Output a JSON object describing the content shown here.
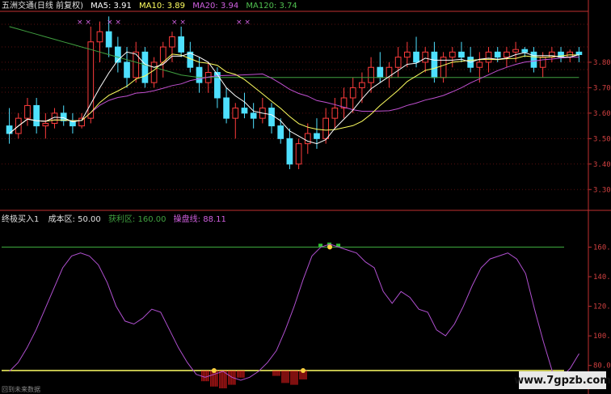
{
  "header": {
    "title": "五洲交通(日线 前复权)",
    "ma5": "MA5: 3.91",
    "ma10": "MA10: 3.89",
    "ma20": "MA20: 3.94",
    "ma120": "MA120: 3.74"
  },
  "indicator_header": {
    "name": "终极买入1",
    "cost": "成本区: 50.00",
    "profit": "获利区: 160.00",
    "trader": "操盘线: 88.11"
  },
  "footer_label": "回到未来数据",
  "watermark": "www.7gpzb.com",
  "colors": {
    "up": "#ff3c3c",
    "down": "#4ee0ff",
    "ma5": "#ffffff",
    "ma10": "#ffff60",
    "ma20": "#c050d0",
    "ma120": "#40a040",
    "trader_line": "#b050d0",
    "cost_line": "#ffff66",
    "profit_line": "#40b040",
    "axis": "#c03030"
  },
  "chart_data": [
    {
      "type": "candlestick",
      "title": "五洲交通(日线 前复权)",
      "ylim": [
        3.25,
        4.0
      ],
      "y_ticks": [
        "3.80",
        "3.70",
        "3.60",
        "3.50",
        "3.40",
        "3.30"
      ],
      "candles": [
        [
          3.55,
          3.62,
          3.48,
          3.52
        ],
        [
          3.52,
          3.6,
          3.5,
          3.58
        ],
        [
          3.58,
          3.66,
          3.55,
          3.63
        ],
        [
          3.63,
          3.66,
          3.52,
          3.55
        ],
        [
          3.55,
          3.6,
          3.5,
          3.56
        ],
        [
          3.56,
          3.62,
          3.54,
          3.6
        ],
        [
          3.6,
          3.63,
          3.55,
          3.57
        ],
        [
          3.57,
          3.6,
          3.52,
          3.55
        ],
        [
          3.55,
          3.6,
          3.54,
          3.58
        ],
        [
          3.58,
          3.94,
          3.56,
          3.88
        ],
        [
          3.88,
          3.96,
          3.8,
          3.92
        ],
        [
          3.92,
          3.98,
          3.82,
          3.86
        ],
        [
          3.86,
          3.9,
          3.76,
          3.8
        ],
        [
          3.8,
          3.86,
          3.7,
          3.74
        ],
        [
          3.74,
          3.88,
          3.72,
          3.84
        ],
        [
          3.84,
          3.86,
          3.7,
          3.72
        ],
        [
          3.72,
          3.82,
          3.7,
          3.8
        ],
        [
          3.8,
          3.88,
          3.74,
          3.86
        ],
        [
          3.86,
          3.92,
          3.8,
          3.9
        ],
        [
          3.9,
          3.94,
          3.82,
          3.84
        ],
        [
          3.84,
          3.88,
          3.76,
          3.78
        ],
        [
          3.78,
          3.82,
          3.68,
          3.72
        ],
        [
          3.72,
          3.8,
          3.68,
          3.76
        ],
        [
          3.76,
          3.78,
          3.62,
          3.66
        ],
        [
          3.66,
          3.7,
          3.56,
          3.58
        ],
        [
          3.58,
          3.64,
          3.5,
          3.62
        ],
        [
          3.62,
          3.68,
          3.58,
          3.6
        ],
        [
          3.6,
          3.64,
          3.54,
          3.58
        ],
        [
          3.58,
          3.66,
          3.56,
          3.62
        ],
        [
          3.62,
          3.64,
          3.52,
          3.55
        ],
        [
          3.55,
          3.58,
          3.48,
          3.5
        ],
        [
          3.5,
          3.54,
          3.38,
          3.4
        ],
        [
          3.4,
          3.5,
          3.38,
          3.48
        ],
        [
          3.48,
          3.56,
          3.44,
          3.52
        ],
        [
          3.52,
          3.58,
          3.46,
          3.5
        ],
        [
          3.5,
          3.62,
          3.48,
          3.58
        ],
        [
          3.58,
          3.66,
          3.54,
          3.62
        ],
        [
          3.62,
          3.7,
          3.58,
          3.66
        ],
        [
          3.66,
          3.74,
          3.6,
          3.7
        ],
        [
          3.7,
          3.76,
          3.64,
          3.72
        ],
        [
          3.72,
          3.82,
          3.68,
          3.78
        ],
        [
          3.78,
          3.84,
          3.72,
          3.74
        ],
        [
          3.74,
          3.8,
          3.7,
          3.78
        ],
        [
          3.78,
          3.86,
          3.74,
          3.82
        ],
        [
          3.82,
          3.88,
          3.78,
          3.84
        ],
        [
          3.84,
          3.9,
          3.78,
          3.8
        ],
        [
          3.8,
          3.86,
          3.76,
          3.84
        ],
        [
          3.84,
          3.88,
          3.72,
          3.74
        ],
        [
          3.74,
          3.84,
          3.72,
          3.82
        ],
        [
          3.82,
          3.86,
          3.78,
          3.84
        ],
        [
          3.84,
          3.88,
          3.8,
          3.82
        ],
        [
          3.82,
          3.86,
          3.76,
          3.78
        ],
        [
          3.78,
          3.84,
          3.72,
          3.8
        ],
        [
          3.8,
          3.86,
          3.76,
          3.84
        ],
        [
          3.84,
          3.86,
          3.8,
          3.82
        ],
        [
          3.82,
          3.86,
          3.78,
          3.84
        ],
        [
          3.84,
          3.88,
          3.8,
          3.85
        ],
        [
          3.85,
          3.86,
          3.82,
          3.84
        ],
        [
          3.84,
          3.86,
          3.76,
          3.78
        ],
        [
          3.78,
          3.84,
          3.74,
          3.82
        ],
        [
          3.82,
          3.86,
          3.8,
          3.84
        ],
        [
          3.84,
          3.86,
          3.8,
          3.82
        ],
        [
          3.82,
          3.85,
          3.8,
          3.84
        ],
        [
          3.84,
          3.86,
          3.8,
          3.83
        ]
      ],
      "ma120": [
        3.94,
        3.93,
        3.92,
        3.91,
        3.9,
        3.89,
        3.88,
        3.87,
        3.86,
        3.85,
        3.84,
        3.83,
        3.82,
        3.81,
        3.8,
        3.79,
        3.78,
        3.77,
        3.76,
        3.75,
        3.745,
        3.74,
        3.74,
        3.74,
        3.74,
        3.74,
        3.74,
        3.74,
        3.74,
        3.74,
        3.74,
        3.74,
        3.74,
        3.74,
        3.74,
        3.74,
        3.74,
        3.74,
        3.74,
        3.74,
        3.74,
        3.74,
        3.74,
        3.74,
        3.74,
        3.74,
        3.74,
        3.74,
        3.74,
        3.74,
        3.74,
        3.74,
        3.74,
        3.74,
        3.74,
        3.74,
        3.74,
        3.74,
        3.74,
        3.74,
        3.74,
        3.74,
        3.74,
        3.74
      ],
      "ma_labels": [
        "MA5",
        "MA10",
        "MA20",
        "MA120"
      ]
    },
    {
      "type": "line",
      "title": "终极买入1",
      "ylim": [
        70,
        175
      ],
      "y_ticks": [
        "160.00",
        "140.00",
        "120.00",
        "100.00",
        "80.00"
      ],
      "series": [
        {
          "name": "操盘线",
          "values": [
            76,
            82,
            92,
            104,
            118,
            132,
            146,
            154,
            156,
            154,
            148,
            136,
            120,
            110,
            108,
            112,
            118,
            116,
            104,
            92,
            82,
            74,
            72,
            74,
            76,
            72,
            70,
            72,
            76,
            82,
            90,
            104,
            120,
            138,
            154,
            160,
            162,
            160,
            158,
            156,
            150,
            146,
            130,
            122,
            130,
            126,
            118,
            116,
            104,
            100,
            108,
            120,
            134,
            146,
            152,
            154,
            156,
            152,
            142,
            118,
            96,
            76,
            72,
            78,
            88
          ]
        },
        {
          "name": "成本区",
          "values": [
            50
          ]
        },
        {
          "name": "获利区",
          "values": [
            160
          ]
        }
      ],
      "cost_bars": [
        0,
        0,
        0,
        0,
        0,
        0,
        0,
        0,
        0,
        0,
        0,
        0,
        0,
        0,
        0,
        0,
        0,
        0,
        0,
        0,
        0,
        0,
        -6,
        -9,
        -10,
        -8,
        -4,
        0,
        0,
        0,
        -3,
        -7,
        -8,
        -5,
        0,
        0,
        0,
        0,
        0,
        0,
        0,
        0,
        0,
        0,
        0,
        0,
        0,
        0,
        0,
        0,
        0,
        0,
        0,
        0,
        0,
        0,
        0,
        0,
        0,
        0,
        0,
        0,
        0,
        0,
        0
      ],
      "profit_bars": [
        0,
        0,
        0,
        0,
        0,
        0,
        0,
        0,
        0,
        0,
        0,
        0,
        0,
        0,
        0,
        0,
        0,
        0,
        0,
        0,
        0,
        0,
        0,
        0,
        0,
        0,
        0,
        0,
        0,
        0,
        0,
        0,
        0,
        0,
        0,
        3,
        4,
        3,
        0,
        0,
        0,
        0,
        0,
        0,
        0,
        0,
        0,
        0,
        0,
        0,
        0,
        0,
        0,
        0,
        0,
        0,
        0,
        0,
        0,
        0,
        0,
        0,
        0,
        0,
        0
      ]
    }
  ]
}
